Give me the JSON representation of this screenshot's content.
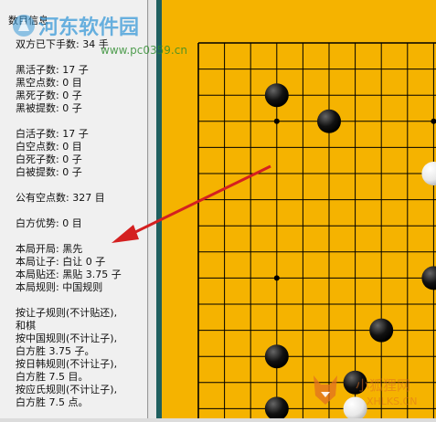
{
  "panel": {
    "title": "数目信息",
    "lines": [
      "双方已下手数: 34 手",
      "",
      "黑活子数: 17 子",
      "黑空点数: 0 目",
      "黑死子数: 0 子",
      "黑被提数: 0 子",
      "",
      "白活子数: 17 子",
      "白空点数: 0 目",
      "白死子数: 0 子",
      "白被提数: 0 子",
      "",
      "公有空点数: 327 目",
      "",
      "白方优势: 0 目",
      "",
      "本局开局: 黑先",
      "本局让子: 白让 0 子",
      "本局贴还: 黑贴 3.75 子",
      "本局规则: 中国规则",
      "",
      "按让子规则(不计贴还),",
      "和棋",
      "按中国规则(不计让子),",
      "白方胜 3.75 子。",
      "按日韩规则(不计让子),",
      "白方胜 7.5 目。",
      "按应氏规则(不计让子),",
      "白方胜 7.5 点。"
    ]
  },
  "watermarks": {
    "top_name": "河东软件园",
    "top_url": "www.pc0359.cn",
    "bottom_name": "小狐狸网",
    "bottom_url": "XHLKS.CN"
  },
  "colors": {
    "board": "#f5b300",
    "panel_bg": "#f0f0f0",
    "arrow": "#d42020",
    "watermark_blue": "#3a9ad9"
  }
}
